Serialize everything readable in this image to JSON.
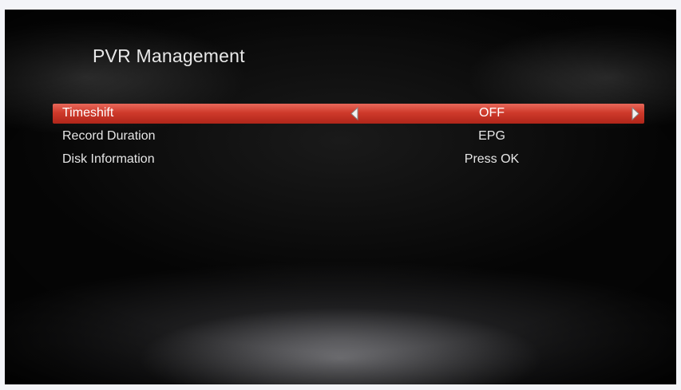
{
  "header": {
    "title": "PVR Management"
  },
  "menu": {
    "items": [
      {
        "label": "Timeshift",
        "value": "OFF",
        "selected": true
      },
      {
        "label": "Record Duration",
        "value": "EPG",
        "selected": false
      },
      {
        "label": "Disk Information",
        "value": "Press OK",
        "selected": false
      }
    ]
  },
  "icons": {
    "left": "arrow-left-icon",
    "right": "arrow-right-icon"
  },
  "colors": {
    "highlight": "#cf3a2b",
    "text": "#e6e6e6",
    "background": "#000000"
  }
}
